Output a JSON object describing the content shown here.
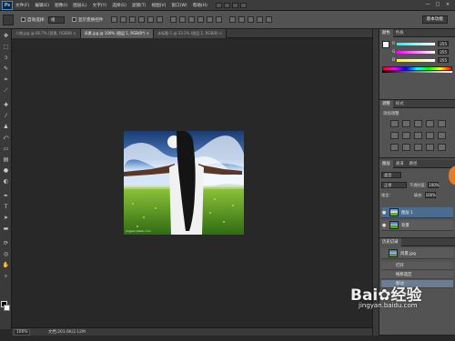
{
  "menubar": {
    "logo": "Ps",
    "items": [
      "文件(F)",
      "编辑(E)",
      "图像(I)",
      "图层(L)",
      "文字(Y)",
      "选择(S)",
      "滤镜(T)",
      "视图(V)",
      "窗口(W)",
      "帮助(H)"
    ],
    "window_controls": [
      "—",
      "□",
      "×"
    ]
  },
  "optbar": {
    "auto_select_label": "自动选择:",
    "auto_select_value": "组",
    "show_transform_label": "显示变换控件",
    "workspace_button": "基本功能"
  },
  "tabs": [
    {
      "label": "人物.jpg @ 66.7% (背景, RGB/8) ×",
      "active": false
    },
    {
      "label": "风景.jpg @ 100% (图层 1, RGB/8*) ×",
      "active": true
    },
    {
      "label": "未标题-1 @ 33.3% (图层 1, RGB/8) ×",
      "active": false
    }
  ],
  "canvas": {
    "image_caption": "jingyan.baidu.com"
  },
  "statusbar": {
    "zoom": "100%",
    "doc_size": "文档:201.6K/2.12M"
  },
  "panels": {
    "color": {
      "tabs": [
        "颜色",
        "色板"
      ],
      "channels": [
        {
          "name": "R",
          "value": "255"
        },
        {
          "name": "G",
          "value": "255"
        },
        {
          "name": "B",
          "value": "255"
        }
      ]
    },
    "adjustments": {
      "tabs": [
        "调整",
        "样式"
      ],
      "title": "添加调整"
    },
    "layers": {
      "tabs": [
        "图层",
        "通道",
        "路径"
      ],
      "kind_label": "类型",
      "blend_mode": "正常",
      "opacity_label": "不透明度:",
      "opacity_value": "100%",
      "lock_label": "锁定:",
      "fill_label": "填充:",
      "fill_value": "100%",
      "items": [
        {
          "name": "图层 1",
          "selected": true
        },
        {
          "name": "背景",
          "selected": false
        }
      ]
    },
    "history": {
      "tabs": [
        "历史记录"
      ],
      "snapshot": "风景.jpg",
      "items": [
        {
          "name": "打开",
          "selected": false
        },
        {
          "name": "拖移选区",
          "selected": false
        },
        {
          "name": "移动",
          "selected": true
        }
      ]
    }
  },
  "watermark": {
    "main": "Bai✿经验",
    "url": "jingyan.baidu.com"
  },
  "colors": {
    "accent_selected_layer": "#4b6c91",
    "orange_tab": "#e67b2a"
  }
}
